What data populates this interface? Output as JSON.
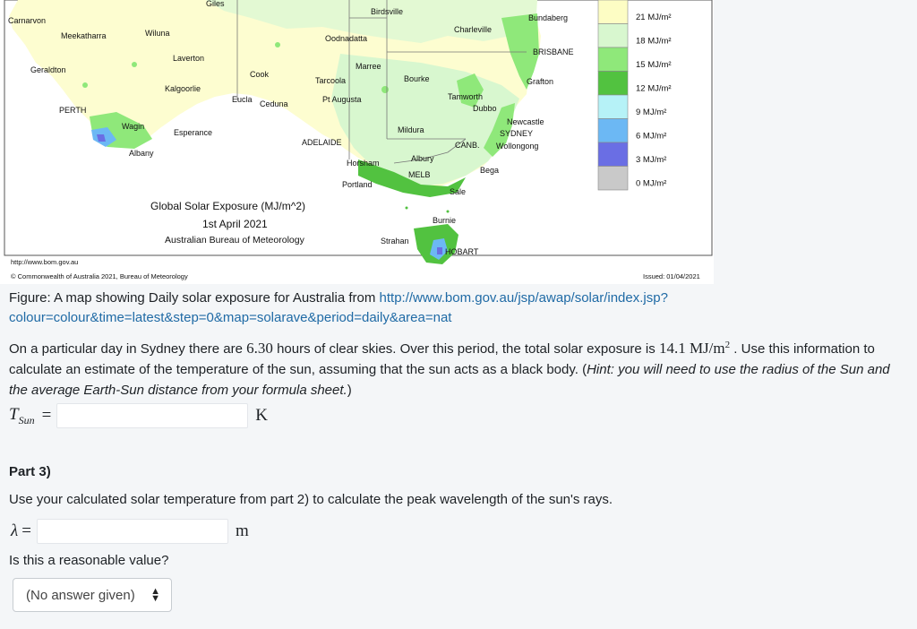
{
  "map": {
    "title": "Global Solar Exposure (MJ/m^2)",
    "date": "1st April 2021",
    "agency": "Australian Bureau of Meteorology",
    "url": "http://www.bom.gov.au",
    "copyright": "© Commonwealth of Australia 2021, Bureau of Meteorology",
    "issued": "Issued: 01/04/2021",
    "places": {
      "carnarvon": "Carnarvon",
      "meekatharra": "Meekatharra",
      "wiluna": "Wiluna",
      "laverton": "Laverton",
      "geraldton": "Geraldton",
      "kalgoorlie": "Kalgoorlie",
      "perth": "PERTH",
      "wagin": "Wagin",
      "esperance": "Esperance",
      "albany": "Albany",
      "giles": "Giles",
      "birdsville": "Birdsville",
      "oodnadatta": "Oodnadatta",
      "marree": "Marree",
      "cook": "Cook",
      "tarcoola": "Tarcoola",
      "eucla": "Eucla",
      "ceduna": "Ceduna",
      "pt_augusta": "Pt Augusta",
      "adelaide": "ADELAIDE",
      "charleville": "Charleville",
      "bourke": "Bourke",
      "bundaberg": "Bundaberg",
      "brisbane": "BRISBANE",
      "grafton": "Grafton",
      "tamworth": "Tamworth",
      "dubbo": "Dubbo",
      "mildura": "Mildura",
      "newcastle": "Newcastle",
      "sydney": "SYDNEY",
      "wollongong": "Wollongong",
      "canberra": "CANB.",
      "albury": "Albury",
      "horsham": "Horsham",
      "melbourne": "MELB",
      "bega": "Bega",
      "portland": "Portland",
      "sale": "Sale",
      "burnie": "Burnie",
      "strahan": "Strahan",
      "hobart": "HOBART"
    },
    "legend": [
      {
        "label": "21 MJ/m²",
        "color": "#fdfdc4"
      },
      {
        "label": "18 MJ/m²",
        "color": "#d8f7cf"
      },
      {
        "label": "15 MJ/m²",
        "color": "#8fe87a"
      },
      {
        "label": "12 MJ/m²",
        "color": "#52c240"
      },
      {
        "label": "9 MJ/m²",
        "color": "#b6f2f7"
      },
      {
        "label": "6 MJ/m²",
        "color": "#6cb8f4"
      },
      {
        "label": "3 MJ/m²",
        "color": "#6a6ee4"
      },
      {
        "label": "0 MJ/m²",
        "color": "#c9c9c9"
      }
    ]
  },
  "caption": {
    "prefix": "Figure: A map showing Daily solar exposure for Australia from ",
    "link": "http://www.bom.gov.au/jsp/awap/solar/index.jsp?colour=colour&time=latest&step=0&map=solarave&period=daily&area=nat"
  },
  "question": {
    "part1": "On a particular day in Sydney there are ",
    "hours": "6.30",
    "part2": " hours of clear skies. Over this period, the total solar exposure is ",
    "exposure": "14.1 MJ/m",
    "exposure_sup": "2",
    "part3": " . Use this information to calculate an estimate of the temperature of the sun, assuming that the sun acts as a black body. (",
    "hint": "Hint: you will need to use the radius of the Sun and the average Earth-Sun distance from your formula sheet.",
    "part4": ")"
  },
  "temperature_answer": {
    "symbol": "T",
    "subscript": "Sun",
    "equals": "=",
    "value": "",
    "unit": "K"
  },
  "part3": {
    "heading": "Part 3)",
    "text": "Use your calculated solar temperature from part 2) to calculate the peak wavelength of the sun's rays."
  },
  "wavelength_answer": {
    "symbol": "λ",
    "equals": "=",
    "value": "",
    "unit": "m"
  },
  "reasonable": {
    "question": "Is this a reasonable value?",
    "selected": "(No answer given)"
  }
}
